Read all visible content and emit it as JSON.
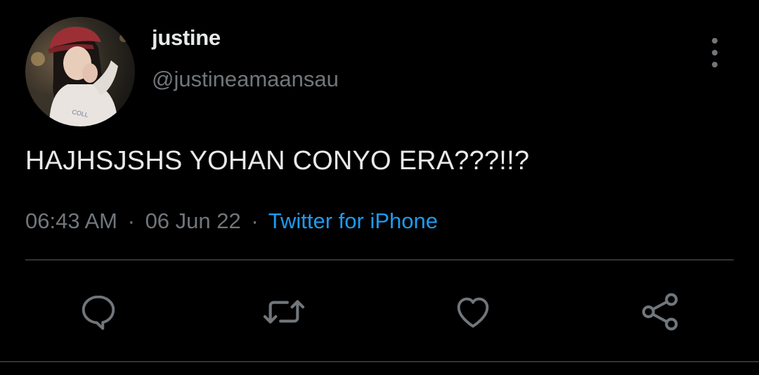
{
  "user": {
    "display_name": "justine",
    "handle": "@justineamaansau",
    "avatar_icon": "profile-photo"
  },
  "tweet": {
    "text": "HAJHSJSHS YOHAN CONYO ERA???!!?",
    "time": "06:43 AM",
    "date": "06 Jun 22",
    "separator": "·",
    "source": "Twitter for iPhone"
  },
  "actions": {
    "reply_icon": "speech-bubble-icon",
    "retweet_icon": "retweet-icon",
    "like_icon": "heart-icon",
    "share_icon": "share-icon"
  },
  "colors": {
    "background": "#000000",
    "text_primary": "#e7e9ea",
    "text_secondary": "#71767b",
    "link": "#1d9bf0",
    "divider": "#2f3336"
  }
}
